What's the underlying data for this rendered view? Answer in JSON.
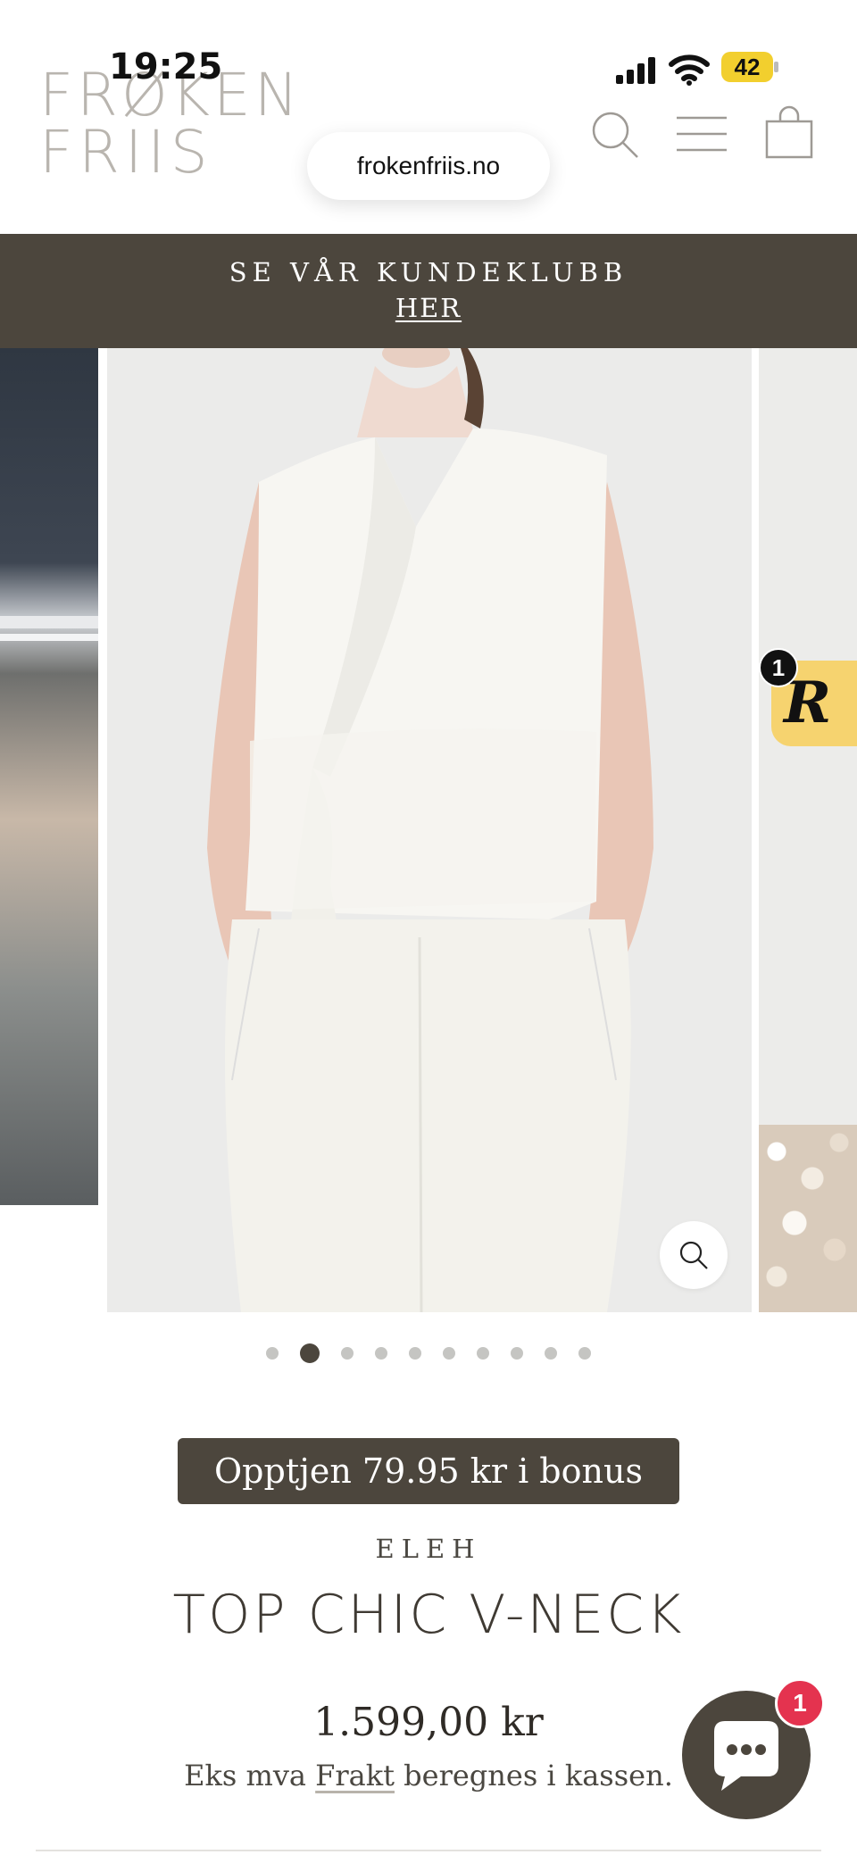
{
  "status_bar": {
    "time": "19:25",
    "battery": "42"
  },
  "browser": {
    "url": "frokenfriis.no"
  },
  "logo": {
    "line1": "FRØKEN",
    "line2": "FRIIS"
  },
  "promo": {
    "line1": "SE VÅR KUNDEKLUBB",
    "link": "HER"
  },
  "gallery": {
    "slide_count": 10,
    "active_index": 1
  },
  "reviews_widget": {
    "count": "1",
    "icon": "R"
  },
  "product": {
    "bonus": "Opptjen 79.95 kr i bonus",
    "brand": "ELEH",
    "title": "TOP CHIC V-NECK",
    "price": "1.599,00 kr",
    "vat_prefix": "Eks mva",
    "shipping_link": "Frakt",
    "vat_suffix": "beregnes i kassen."
  },
  "chat": {
    "unread": "1"
  },
  "colors": {
    "brand_dark": "#4c463d",
    "badge_red": "#e4334f",
    "reviews_yellow": "#f6d36f"
  }
}
